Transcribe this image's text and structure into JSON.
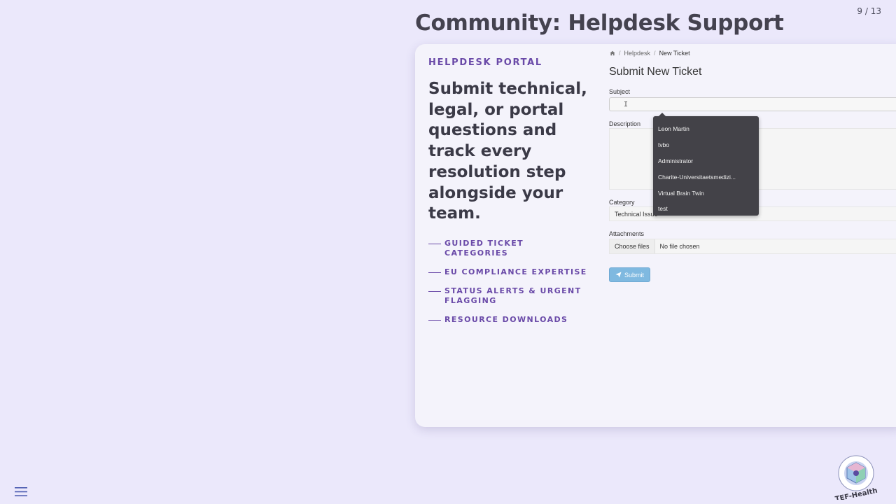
{
  "slide": {
    "counter": "9 / 13",
    "title": "Community: Helpdesk Support"
  },
  "intro": {
    "eyebrow": "HELPDESK PORTAL",
    "headline": "Submit technical, legal, or portal questions and track every resolution step alongside your team.",
    "features": [
      "GUIDED TICKET CATEGORIES",
      "EU COMPLIANCE EXPERTISE",
      "STATUS ALERTS & URGENT FLAGGING",
      "RESOURCE DOWNLOADS"
    ]
  },
  "portal": {
    "breadcrumb": {
      "home_icon": "home-icon",
      "link": "Helpdesk",
      "separator": "/",
      "current": "New Ticket"
    },
    "form_title": "Submit New Ticket",
    "subject_label": "Subject",
    "subject_value": "",
    "description_label": "Description",
    "category_label": "Category",
    "category_value": "Technical Issue",
    "attachments_label": "Attachments",
    "choose_files_label": "Choose files",
    "no_file_text": "No file chosen",
    "submit_label": "Submit",
    "submit_icon": "paper-plane-icon",
    "autocomplete_options": [
      "Leon Martin",
      "tvbo",
      "Administrator",
      "Charite-Universitaetsmedizi...",
      "Virtual Brain Twin",
      "test"
    ]
  },
  "footer": {
    "menu_icon": "hamburger-menu-icon",
    "logo_text": "TEF-Health"
  },
  "colors": {
    "background": "#ebe8fb",
    "accent": "#6a4aa8",
    "submit": "#7fb9e0",
    "dropdown": "#434248"
  }
}
